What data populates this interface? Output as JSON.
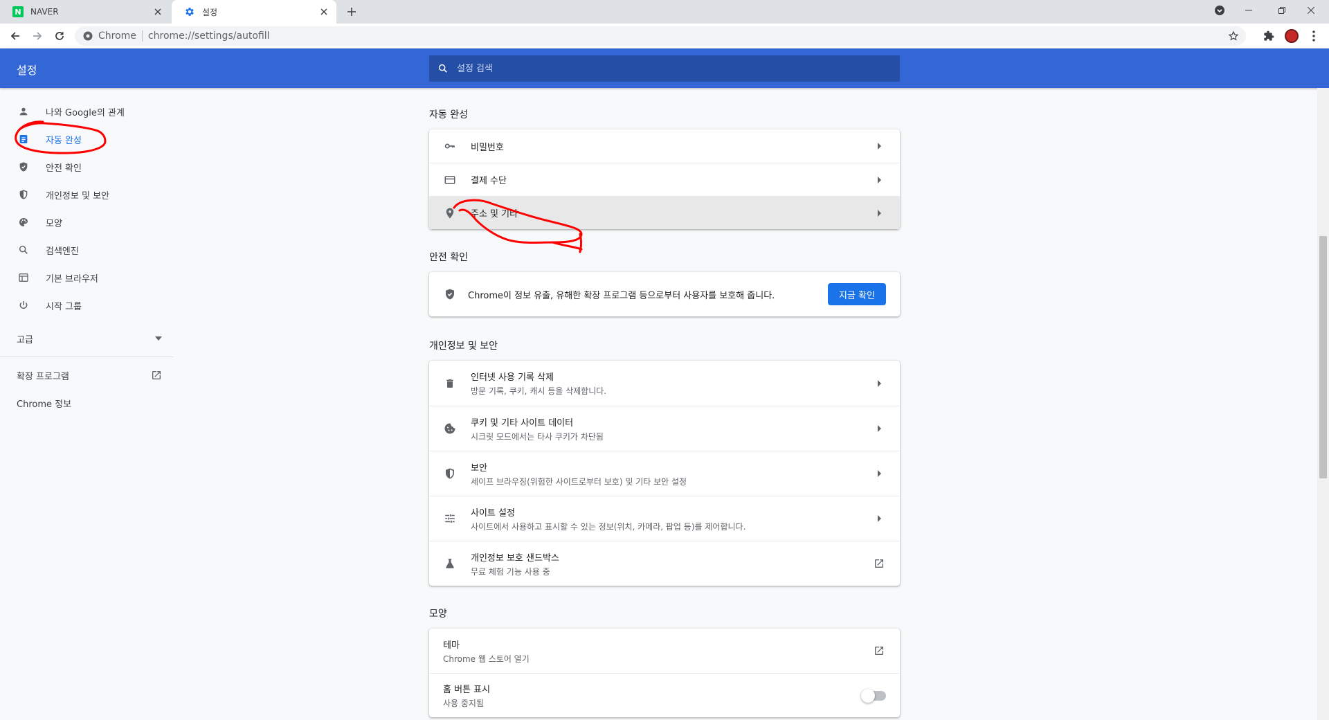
{
  "browser": {
    "tabs": [
      {
        "title": "NAVER",
        "favicon": "naver-logo-icon",
        "favicon_letter": "N",
        "active": false
      },
      {
        "title": "설정",
        "favicon": "gear-icon",
        "active": true
      }
    ],
    "address": {
      "chip": "Chrome",
      "url": "chrome://settings/autofill"
    }
  },
  "header": {
    "title": "설정",
    "search_placeholder": "설정 검색"
  },
  "sidebar": {
    "items": [
      {
        "label": "나와 Google의 관계",
        "icon": "person-icon"
      },
      {
        "label": "자동 완성",
        "icon": "clipboard-icon",
        "selected": true
      },
      {
        "label": "안전 확인",
        "icon": "shield-check-icon"
      },
      {
        "label": "개인정보 및 보안",
        "icon": "shield-icon"
      },
      {
        "label": "모양",
        "icon": "palette-icon"
      },
      {
        "label": "검색엔진",
        "icon": "search-icon"
      },
      {
        "label": "기본 브라우저",
        "icon": "browser-window-icon"
      },
      {
        "label": "시작 그룹",
        "icon": "power-icon"
      }
    ],
    "advanced": "고급",
    "extensions": "확장 프로그램",
    "about": "Chrome 정보"
  },
  "main": {
    "autofill": {
      "title": "자동 완성",
      "rows": [
        {
          "label": "비밀번호",
          "icon": "key-icon"
        },
        {
          "label": "결제 수단",
          "icon": "credit-card-icon"
        },
        {
          "label": "주소 및 기타",
          "icon": "location-pin-icon"
        }
      ]
    },
    "safety": {
      "title": "안전 확인",
      "text": "Chrome이 정보 유출, 유해한 확장 프로그램 등으로부터 사용자를 보호해 줍니다.",
      "button": "지금 확인"
    },
    "privacy": {
      "title": "개인정보 및 보안",
      "rows": [
        {
          "primary": "인터넷 사용 기록 삭제",
          "secondary": "방문 기록, 쿠키, 캐시 등을 삭제합니다.",
          "icon": "trash-icon"
        },
        {
          "primary": "쿠키 및 기타 사이트 데이터",
          "secondary": "시크릿 모드에서는 타사 쿠키가 차단됨",
          "icon": "cookie-icon"
        },
        {
          "primary": "보안",
          "secondary": "세이프 브라우징(위험한 사이트로부터 보호) 및 기타 보안 설정",
          "icon": "shield-icon"
        },
        {
          "primary": "사이트 설정",
          "secondary": "사이트에서 사용하고 표시할 수 있는 정보(위치, 카메라, 팝업 등)를 제어합니다.",
          "icon": "tune-icon"
        },
        {
          "primary": "개인정보 보호 샌드박스",
          "secondary": "무료 체험 기능 사용 중",
          "icon": "flask-icon"
        }
      ]
    },
    "appearance": {
      "title": "모양",
      "rows": [
        {
          "primary": "테마",
          "secondary": "Chrome 웹 스토어 열기"
        },
        {
          "primary": "홈 버튼 표시",
          "secondary": "사용 중지됨",
          "toggle_on": false
        }
      ]
    }
  },
  "colors": {
    "header_blue": "#3367d6",
    "accent_blue": "#1a73e8",
    "annotation_red": "#ff0000"
  }
}
